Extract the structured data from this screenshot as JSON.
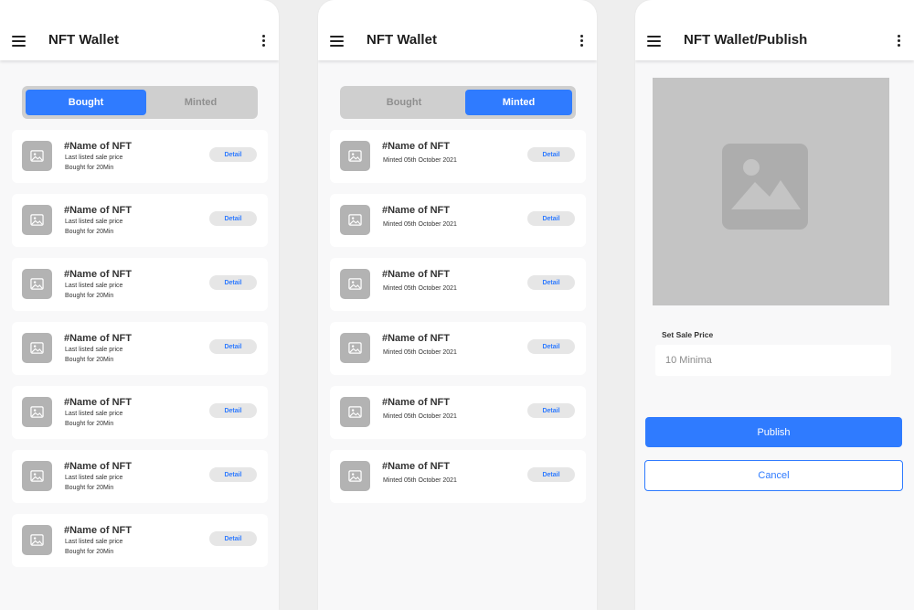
{
  "screens": [
    {
      "title": "NFT Wallet",
      "tabs": [
        {
          "label": "Bought",
          "active": true
        },
        {
          "label": "Minted",
          "active": false
        }
      ],
      "items": [
        {
          "name": "#Name of NFT",
          "line1": "Last listed sale price",
          "line2": "Bought for 20Min",
          "action": "Detail"
        },
        {
          "name": "#Name of NFT",
          "line1": "Last listed sale price",
          "line2": "Bought for 20Min",
          "action": "Detail"
        },
        {
          "name": "#Name of NFT",
          "line1": "Last listed sale price",
          "line2": "Bought for 20Min",
          "action": "Detail"
        },
        {
          "name": "#Name of NFT",
          "line1": "Last listed sale price",
          "line2": "Bought for 20Min",
          "action": "Detail"
        },
        {
          "name": "#Name of NFT",
          "line1": "Last listed sale price",
          "line2": "Bought for 20Min",
          "action": "Detail"
        },
        {
          "name": "#Name of NFT",
          "line1": "Last listed sale price",
          "line2": "Bought for 20Min",
          "action": "Detail"
        },
        {
          "name": "#Name of NFT",
          "line1": "Last listed sale price",
          "line2": "Bought for 20Min",
          "action": "Detail"
        }
      ]
    },
    {
      "title": "NFT Wallet",
      "tabs": [
        {
          "label": "Bought",
          "active": false
        },
        {
          "label": "Minted",
          "active": true
        }
      ],
      "items": [
        {
          "name": "#Name of NFT",
          "line1": "Minted 05th October 2021",
          "action": "Detail"
        },
        {
          "name": "#Name of NFT",
          "line1": "Minted 05th October 2021",
          "action": "Detail"
        },
        {
          "name": "#Name of NFT",
          "line1": "Minted 05th October 2021",
          "action": "Detail"
        },
        {
          "name": "#Name of NFT",
          "line1": "Minted 05th October 2021",
          "action": "Detail"
        },
        {
          "name": "#Name of NFT",
          "line1": "Minted 05th October 2021",
          "action": "Detail"
        },
        {
          "name": "#Name of NFT",
          "line1": "Minted 05th October 2021",
          "action": "Detail"
        }
      ]
    },
    {
      "title": "NFT Wallet/Publish",
      "price_label": "Set Sale Price",
      "price_placeholder": "10 Minima",
      "publish_label": "Publish",
      "cancel_label": "Cancel"
    }
  ],
  "colors": {
    "accent": "#2f7bff",
    "placeholder_gray": "#c4c4c4",
    "toggle_bg": "#cfcfcf"
  },
  "icons": {
    "menu": "hamburger-menu-icon",
    "more": "more-vertical-icon",
    "image": "image-placeholder-icon"
  }
}
